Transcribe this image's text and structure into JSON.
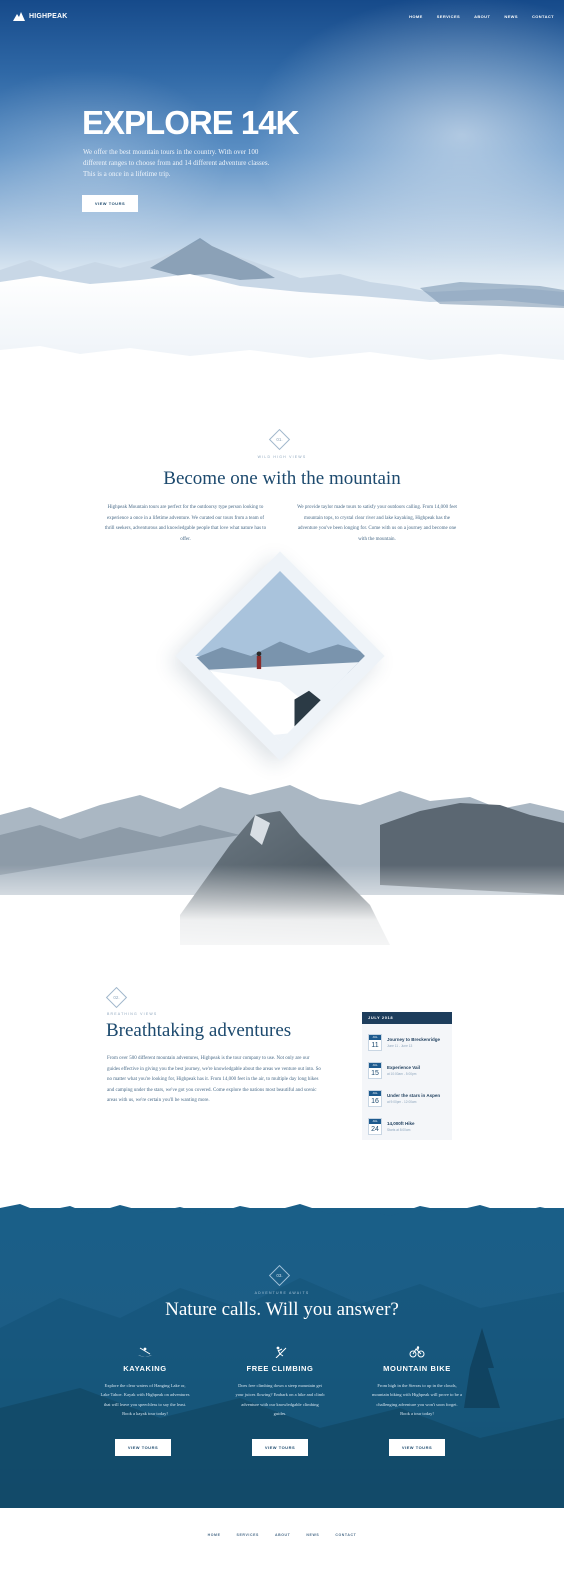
{
  "header": {
    "brand": "HIGHPEAK",
    "nav": [
      "HOME",
      "SERVICES",
      "ABOUT",
      "NEWS",
      "CONTACT"
    ]
  },
  "hero": {
    "title": "EXPLORE 14K",
    "text": "We offer the best mountain tours in the country. With over 100 different ranges to choose from and 14 different adventure classes. This is a once in a lifetime trip.",
    "button": "VIEW TOURS"
  },
  "section1": {
    "number": "01.",
    "eyebrow": "WILD HIGH VIEWS",
    "title": "Become one with the mountain",
    "para_left": "Highpeak Mountain tours are perfect for the outdoorsy type person looking to experience a once in a lifetime adventure. We curated our tours from a team of thrill seekers, adventurous and knowledgable people that love what nature has to offer.",
    "para_right": "We provide taylor made tours to satisfy your outdoors calling. From 14,000 feet mountain tops, to crystal clear river and lake kayaking, Highpeak has the adventure you've been longing for. Come with us on a journey and become one with the mountain."
  },
  "section2": {
    "number": "02.",
    "eyebrow": "BREATHING VIEWS",
    "title": "Breathtaking adventures",
    "text": "From over 500 different mountain adventures, Highpeak is the tour company to use. Not only are our guides effective in giving you the best journey, we're knowledgable about the areas we venture out into. So no matter what you're looking for, Highpeak has it. From 14,000 feet in the air, to multiple day long hikes and camping under the stars, we've got you covered. Come explore the nations most beautiful and scenic areas with us, we're certain you'll be wanting more."
  },
  "calendar": {
    "month": "JULY 2018",
    "events": [
      {
        "month": "JUL",
        "day": "11",
        "title": "Journey to Breckenridge",
        "sub": "June 11 - June 13"
      },
      {
        "month": "JUL",
        "day": "15",
        "title": "Experience Vail",
        "sub": "at 10:00am - 5:00pm"
      },
      {
        "month": "JUL",
        "day": "16",
        "title": "Under the stars in Aspen",
        "sub": "at 9:00pm - 12:00am"
      },
      {
        "month": "JUL",
        "day": "24",
        "title": "14,000ft Hike",
        "sub": "Starts at 8:00am"
      }
    ]
  },
  "section3": {
    "number": "03.",
    "eyebrow": "ADVENTURE AWAITS",
    "title": "Nature calls. Will you answer?",
    "activities": [
      {
        "icon": "kayak-icon",
        "title": "KAYAKING",
        "text": "Explore the clear waters of Hanging Lake or, Lake Tahoe. Kayak with Highpeak on adventures that will leave you speechless to say the least. Book a kayak tour today!",
        "button": "VIEW TOURS"
      },
      {
        "icon": "climbing-icon",
        "title": "FREE CLIMBING",
        "text": "Does free climbing down a steep mountain get your juices flowing? Embark on a hike and climb adventure with our knowledgable climbing guides.",
        "button": "VIEW TOURS"
      },
      {
        "icon": "bike-icon",
        "title": "MOUNTAIN BIKE",
        "text": "From high in the Sierras to up in the clouds, mountain biking with Highpeak will prove to be a challenging adventure you won't soon forget. Book a tour today!",
        "button": "VIEW TOURS"
      }
    ]
  },
  "footer": {
    "nav": [
      "HOME",
      "SERVICES",
      "ABOUT",
      "NEWS",
      "CONTACT"
    ]
  }
}
